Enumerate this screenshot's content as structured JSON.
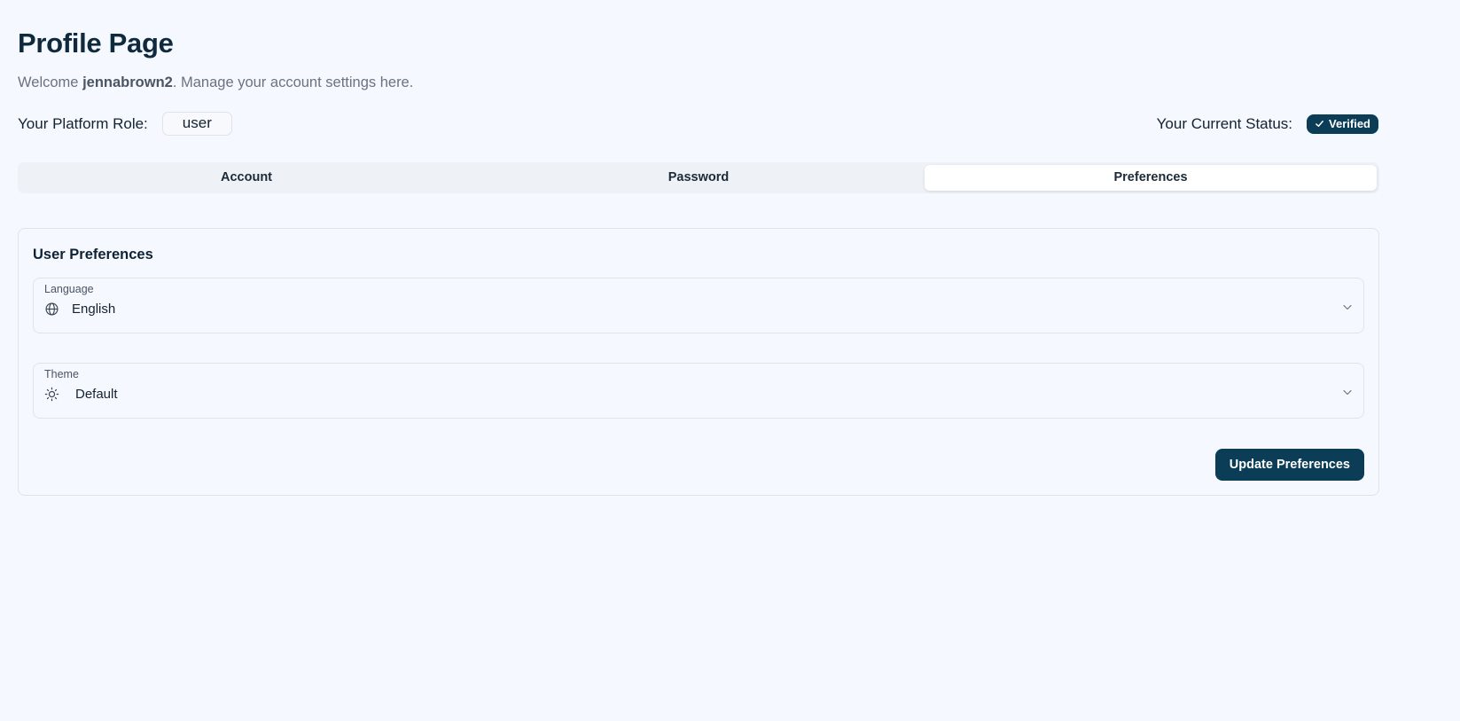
{
  "header": {
    "title": "Profile Page",
    "welcome_prefix": "Welcome ",
    "username": "jennabrown2",
    "welcome_suffix": ". Manage your account settings here."
  },
  "role": {
    "label": "Your Platform Role:",
    "value": "user"
  },
  "status": {
    "label": "Your Current Status:",
    "value": "Verified",
    "icon": "check-icon"
  },
  "tabs": [
    {
      "label": "Account",
      "active": false
    },
    {
      "label": "Password",
      "active": false
    },
    {
      "label": "Preferences",
      "active": true
    }
  ],
  "preferences": {
    "title": "User Preferences",
    "language": {
      "label": "Language",
      "value": "English",
      "icon": "globe-icon"
    },
    "theme": {
      "label": "Theme",
      "value": "Default",
      "icon": "sun-icon"
    },
    "submit_label": "Update Preferences"
  },
  "colors": {
    "background": "#f5f8fe",
    "accent": "#0b3d57",
    "border": "#dfe4ec"
  }
}
